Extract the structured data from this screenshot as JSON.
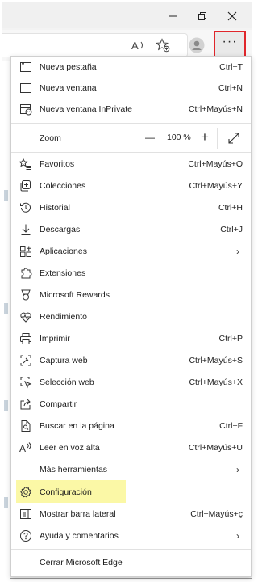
{
  "window": {
    "min": "—",
    "restore": "⧉",
    "close": "✕"
  },
  "toolbar": {
    "more_label": "···"
  },
  "menu": {
    "groups": [
      [
        {
          "label": "Nueva pestaña",
          "shortcut": "Ctrl+T",
          "icon": "new-tab-icon"
        },
        {
          "label": "Nueva ventana",
          "shortcut": "Ctrl+N",
          "icon": "new-window-icon"
        },
        {
          "label": "Nueva ventana InPrivate",
          "shortcut": "Ctrl+Mayús+N",
          "icon": "inprivate-icon"
        }
      ],
      [
        {
          "label": "Zoom",
          "zoom_value": "100 %",
          "minus": "—",
          "plus": "+",
          "icon": "fullscreen-icon"
        }
      ],
      [
        {
          "label": "Favoritos",
          "shortcut": "Ctrl+Mayús+O",
          "icon": "favorites-icon"
        },
        {
          "label": "Colecciones",
          "shortcut": "Ctrl+Mayús+Y",
          "icon": "collections-icon"
        },
        {
          "label": "Historial",
          "shortcut": "Ctrl+H",
          "icon": "history-icon"
        },
        {
          "label": "Descargas",
          "shortcut": "Ctrl+J",
          "icon": "download-icon"
        },
        {
          "label": "Aplicaciones",
          "submenu": true,
          "icon": "apps-icon"
        },
        {
          "label": "Extensiones",
          "icon": "extensions-icon"
        },
        {
          "label": "Microsoft Rewards",
          "icon": "rewards-icon"
        },
        {
          "label": "Rendimiento",
          "icon": "performance-icon"
        }
      ],
      [
        {
          "label": "Imprimir",
          "shortcut": "Ctrl+P",
          "icon": "print-icon"
        },
        {
          "label": "Captura web",
          "shortcut": "Ctrl+Mayús+S",
          "icon": "web-capture-icon"
        },
        {
          "label": "Selección web",
          "shortcut": "Ctrl+Mayús+X",
          "icon": "web-select-icon"
        },
        {
          "label": "Compartir",
          "icon": "share-icon"
        },
        {
          "label": "Buscar en la página",
          "shortcut": "Ctrl+F",
          "icon": "find-icon"
        },
        {
          "label": "Leer en voz alta",
          "shortcut": "Ctrl+Mayús+U",
          "icon": "read-aloud-icon"
        },
        {
          "label": "Más herramientas",
          "submenu": true,
          "icon": ""
        }
      ],
      [
        {
          "label": "Configuración",
          "icon": "settings-icon",
          "highlighted": true
        },
        {
          "label": "Mostrar barra lateral",
          "shortcut": "Ctrl+Mayús+ç",
          "icon": "sidebar-icon"
        },
        {
          "label": "Ayuda y comentarios",
          "submenu": true,
          "icon": "help-icon"
        }
      ],
      [
        {
          "label": "Cerrar Microsoft Edge"
        }
      ]
    ]
  },
  "colors": {
    "highlight": "#fbf8a6",
    "more_border": "#e0262b"
  }
}
